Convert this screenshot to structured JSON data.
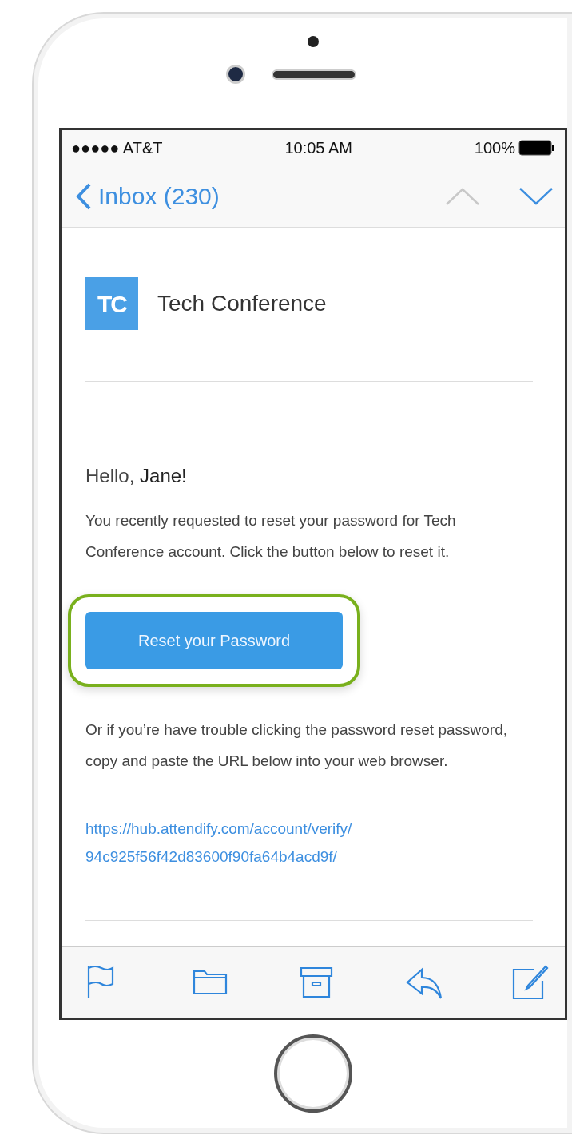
{
  "status_bar": {
    "carrier": "●●●●● AT&T",
    "time": "10:05 AM",
    "battery": "100%"
  },
  "nav_bar": {
    "back_label": "Inbox (230)",
    "previous_disabled": true,
    "next_disabled": false
  },
  "email": {
    "sender_logo": "TC",
    "sender_name": "Tech Conference",
    "greeting": "Hello, **Jane!**",
    "message": "You recently requested to reset your password for Tech Conference account. Click the button below to reset it.",
    "button": {
      "label": "Reset your Password",
      "highlighted": true
    },
    "fallback_text": "Or if you’re have trouble clicking the password reset password, copy and paste the URL below into your web browser.",
    "url_lines": [
      "https://hub.attendify.com/account/verify/",
      "94c925f56f42d83600f90fa64b4acd9f/"
    ]
  },
  "toolbar": [
    {
      "kind": "flag"
    },
    {
      "kind": "folder"
    },
    {
      "kind": "archive"
    },
    {
      "kind": "reply"
    },
    {
      "kind": "compose"
    }
  ]
}
